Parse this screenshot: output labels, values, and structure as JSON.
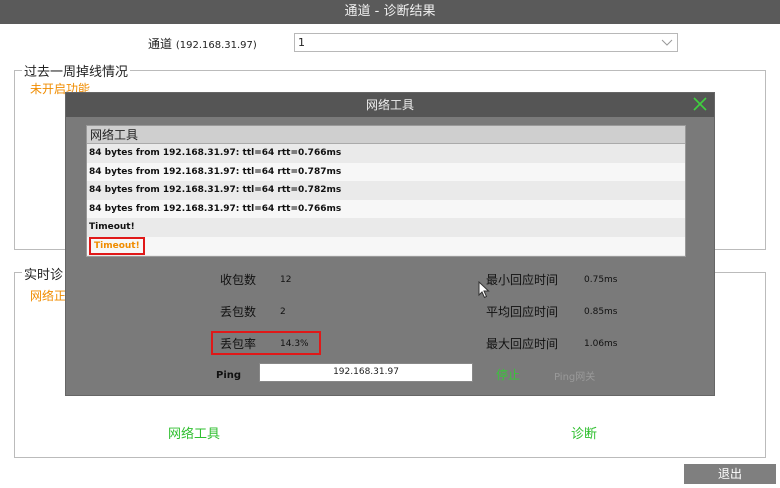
{
  "window": {
    "title": "通道 - 诊断结果"
  },
  "channel": {
    "label": "通道",
    "ip": "(192.168.31.97)",
    "selected": "1"
  },
  "section_offline": {
    "title": "过去一周掉线情况",
    "status": "未开启功能"
  },
  "section_realtime": {
    "title": "实时诊",
    "status": "网络正"
  },
  "dialog": {
    "title": "网络工具",
    "log_header": "网络工具",
    "log_rows": [
      "84 bytes from 192.168.31.97: ttl=64 rtt=0.766ms",
      "84 bytes from 192.168.31.97: ttl=64 rtt=0.787ms",
      "84 bytes from 192.168.31.97: ttl=64 rtt=0.782ms",
      "84 bytes from 192.168.31.97: ttl=64 rtt=0.766ms",
      "Timeout!",
      "Timeout!"
    ],
    "stats": {
      "received_label": "收包数",
      "received": "12",
      "lost_label": "丢包数",
      "lost": "2",
      "loss_rate_label": "丢包率",
      "loss_rate": "14.3%",
      "min_label": "最小回应时间",
      "min": "0.75ms",
      "avg_label": "平均回应时间",
      "avg": "0.85ms",
      "max_label": "最大回应时间",
      "max": "1.06ms"
    },
    "ping_label": "Ping",
    "ping_value": "192.168.31.97",
    "stop_label": "停止",
    "gateway_label": "Ping网关"
  },
  "footer": {
    "network_tool": "网络工具",
    "diagnose": "诊断",
    "exit": "退出"
  },
  "colors": {
    "accent_orange": "#f08c00",
    "accent_green": "#39c639",
    "highlight_red": "#e01818"
  }
}
